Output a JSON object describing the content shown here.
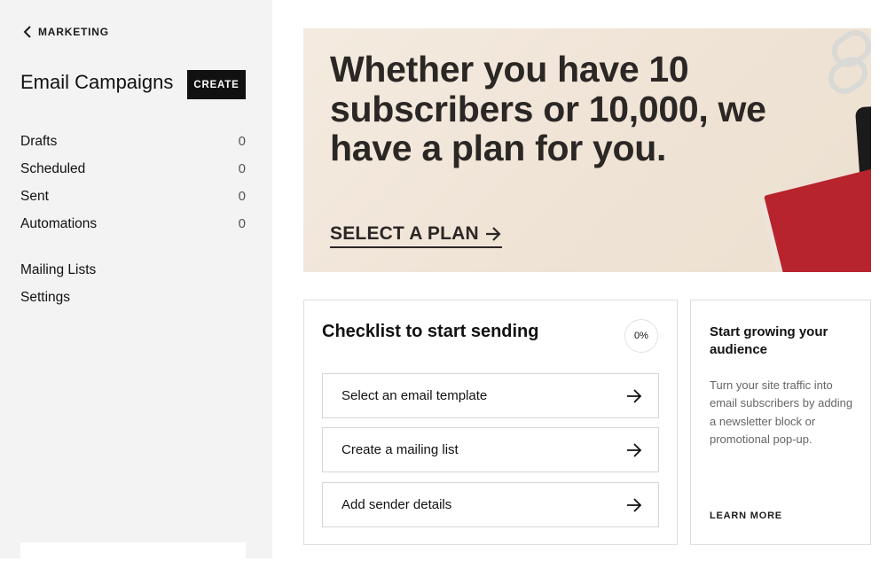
{
  "sidebar": {
    "back_label": "MARKETING",
    "title": "Email Campaigns",
    "create_label": "CREATE",
    "counts": [
      {
        "label": "Drafts",
        "count": "0"
      },
      {
        "label": "Scheduled",
        "count": "0"
      },
      {
        "label": "Sent",
        "count": "0"
      },
      {
        "label": "Automations",
        "count": "0"
      }
    ],
    "links": [
      {
        "label": "Mailing Lists"
      },
      {
        "label": "Settings"
      }
    ]
  },
  "hero": {
    "headline": "Whether you have 10 subscribers or 10,000, we have a plan for you.",
    "cta_label": "SELECT A PLAN",
    "cta_icon": "arrow-right-icon",
    "text_color": "#2b2725",
    "notebook_color": "#b8242e"
  },
  "checklist": {
    "title": "Checklist to start sending",
    "progress": "0%",
    "tasks": [
      {
        "label": "Select an email template",
        "icon": "arrow-right-icon"
      },
      {
        "label": "Create a mailing list",
        "icon": "arrow-right-icon"
      },
      {
        "label": "Add sender details",
        "icon": "arrow-right-icon"
      }
    ]
  },
  "audience": {
    "title": "Start growing your audience",
    "body": "Turn your site traffic into email subscribers by adding a newsletter block or promotional pop-up.",
    "link_label": "LEARN MORE"
  }
}
